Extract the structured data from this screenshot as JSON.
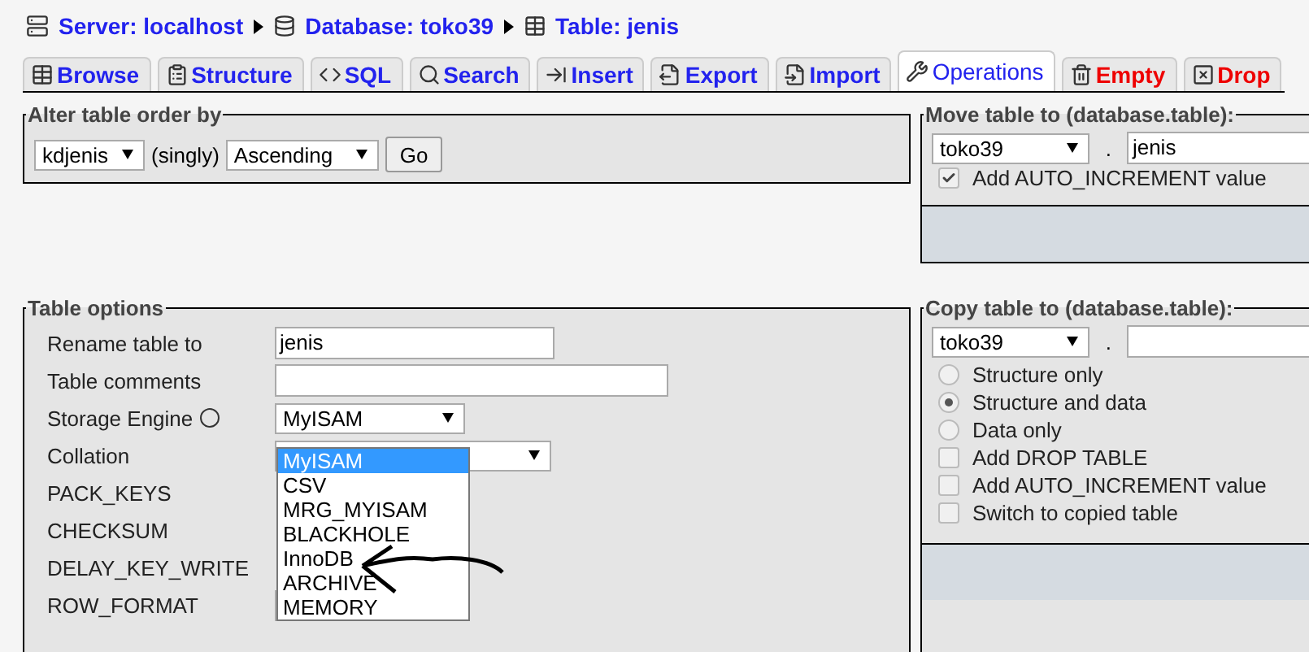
{
  "breadcrumb": [
    {
      "kind": "server",
      "label": "Server: localhost"
    },
    {
      "kind": "database",
      "label": "Database: toko39"
    },
    {
      "kind": "table",
      "label": "Table: jenis"
    }
  ],
  "tabs": [
    {
      "kind": "browse",
      "label": "Browse",
      "selected": false,
      "danger": false
    },
    {
      "kind": "structure",
      "label": "Structure",
      "selected": false,
      "danger": false
    },
    {
      "kind": "sql",
      "label": "SQL",
      "selected": false,
      "danger": false
    },
    {
      "kind": "search",
      "label": "Search",
      "selected": false,
      "danger": false
    },
    {
      "kind": "insert",
      "label": "Insert",
      "selected": false,
      "danger": false
    },
    {
      "kind": "export",
      "label": "Export",
      "selected": false,
      "danger": false
    },
    {
      "kind": "import",
      "label": "Import",
      "selected": false,
      "danger": false
    },
    {
      "kind": "operations",
      "label": "Operations",
      "selected": true,
      "danger": false
    },
    {
      "kind": "empty",
      "label": "Empty",
      "selected": false,
      "danger": true
    },
    {
      "kind": "drop",
      "label": "Drop",
      "selected": false,
      "danger": true
    }
  ],
  "alter_order": {
    "legend": "Alter table order by",
    "column": "kdjenis",
    "singly": "(singly)",
    "direction": "Ascending",
    "button": "Go"
  },
  "table_options": {
    "legend": "Table options",
    "rows": [
      {
        "kind": "text",
        "label": "Rename table to",
        "value": "jenis"
      },
      {
        "kind": "wide",
        "label": "Table comments"
      },
      {
        "kind": "engine",
        "label": "Storage Engine",
        "value": "MyISAM"
      },
      {
        "kind": "collation",
        "label": "Collation"
      },
      {
        "kind": "plain",
        "label": "PACK_KEYS"
      },
      {
        "kind": "plain",
        "label": "CHECKSUM"
      },
      {
        "kind": "plain",
        "label": "DELAY_KEY_WRITE"
      },
      {
        "kind": "rowformat",
        "label": "ROW_FORMAT"
      }
    ],
    "engine_options": [
      {
        "label": "MyISAM",
        "selected": true
      },
      {
        "label": "CSV",
        "selected": false
      },
      {
        "label": "MRG_MYISAM",
        "selected": false
      },
      {
        "label": "BLACKHOLE",
        "selected": false
      },
      {
        "label": "InnoDB",
        "selected": false
      },
      {
        "label": "ARCHIVE",
        "selected": false
      },
      {
        "label": "MEMORY",
        "selected": false
      }
    ]
  },
  "move_table": {
    "legend": "Move table to (database.table):",
    "database": "toko39",
    "separator": ".",
    "table": "jenis",
    "options": [
      {
        "kind": "checkbox",
        "label": "Add AUTO_INCREMENT value",
        "checked": true
      }
    ]
  },
  "copy_table": {
    "legend": "Copy table to (database.table):",
    "database": "toko39",
    "separator": ".",
    "options": [
      {
        "kind": "radio",
        "label": "Structure only",
        "selected": false
      },
      {
        "kind": "radio",
        "label": "Structure and data",
        "selected": true
      },
      {
        "kind": "radio",
        "label": "Data only",
        "selected": false
      },
      {
        "kind": "checkbox",
        "label": "Add DROP TABLE",
        "checked": false
      },
      {
        "kind": "checkbox",
        "label": "Add AUTO_INCREMENT value",
        "checked": false
      },
      {
        "kind": "checkbox",
        "label": "Switch to copied table",
        "checked": false
      }
    ]
  }
}
